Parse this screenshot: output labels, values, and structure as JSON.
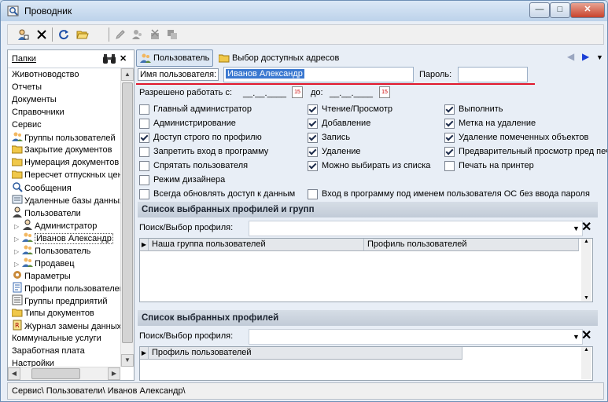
{
  "window": {
    "title": "Проводник",
    "minimize": "—",
    "maximize": "□",
    "close": "✕"
  },
  "left_panel": {
    "header": "Папки",
    "tree": [
      {
        "label": "Животноводство",
        "indent": 0,
        "icon": ""
      },
      {
        "label": "Отчеты",
        "indent": 0,
        "icon": ""
      },
      {
        "label": "Документы",
        "indent": 0,
        "icon": ""
      },
      {
        "label": "Справочники",
        "indent": 0,
        "icon": ""
      },
      {
        "label": "Сервис",
        "indent": 0,
        "icon": ""
      },
      {
        "label": "Группы пользователей",
        "indent": 1,
        "icon": "users-icon"
      },
      {
        "label": "Закрытие документов",
        "indent": 1,
        "icon": "folder-icon"
      },
      {
        "label": "Нумерация документов",
        "indent": 1,
        "icon": "folder-icon"
      },
      {
        "label": "Пересчет отпускных цен",
        "indent": 1,
        "icon": "folder-icon"
      },
      {
        "label": "Сообщения",
        "indent": 1,
        "icon": "message-icon"
      },
      {
        "label": "Удаленные базы данных",
        "indent": 1,
        "icon": "database-icon"
      },
      {
        "label": "Пользователи",
        "indent": 1,
        "icon": "user-icon"
      },
      {
        "label": "Администратор",
        "indent": 2,
        "icon": "user-icon"
      },
      {
        "label": "Иванов Александр",
        "indent": 2,
        "icon": "users-icon",
        "selected": true
      },
      {
        "label": "Пользователь",
        "indent": 2,
        "icon": "users-icon"
      },
      {
        "label": "Продавец",
        "indent": 2,
        "icon": "users-icon"
      },
      {
        "label": "Параметры",
        "indent": 1,
        "icon": "gear-icon"
      },
      {
        "label": "Профили пользователей",
        "indent": 1,
        "icon": "profile-icon"
      },
      {
        "label": "Группы предприятий",
        "indent": 1,
        "icon": "list-icon"
      },
      {
        "label": "Типы документов",
        "indent": 1,
        "icon": "folder-icon"
      },
      {
        "label": "Журнал замены данных",
        "indent": 1,
        "icon": "journal-icon"
      },
      {
        "label": "Коммунальные услуги",
        "indent": 0,
        "icon": ""
      },
      {
        "label": "Заработная плата",
        "indent": 0,
        "icon": ""
      },
      {
        "label": "Настройки",
        "indent": 0,
        "icon": ""
      }
    ]
  },
  "tabs": {
    "user": "Пользователь",
    "addresses": "Выбор доступных адресов"
  },
  "form": {
    "username_label": "Имя пользователя:",
    "username_value": "Иванов Александр",
    "password_label": "Пароль:",
    "password_value": "",
    "allowed_from_label": "Разрешено работать с:",
    "date_placeholder": "__.__.____",
    "to_label": "до:",
    "calendar_day": "15"
  },
  "checkboxes": {
    "col1": [
      {
        "label": "Главный администратор",
        "checked": false
      },
      {
        "label": "Администрирование",
        "checked": false
      },
      {
        "label": "Доступ строго по профилю",
        "checked": true
      },
      {
        "label": "Запретить вход в программу",
        "checked": false
      },
      {
        "label": "Спрятать пользователя",
        "checked": false
      },
      {
        "label": "Режим дизайнера",
        "checked": false
      },
      {
        "label": "Всегда обновлять доступ к данным",
        "checked": false
      }
    ],
    "col2": [
      {
        "label": "Чтение/Просмотр",
        "checked": true
      },
      {
        "label": "Добавление",
        "checked": true
      },
      {
        "label": "Запись",
        "checked": true
      },
      {
        "label": "Удаление",
        "checked": true
      },
      {
        "label": "Можно выбирать из списка",
        "checked": true
      }
    ],
    "col3": [
      {
        "label": "Выполнить",
        "checked": true
      },
      {
        "label": "Метка на удаление",
        "checked": true
      },
      {
        "label": "Удаление помеченных объектов",
        "checked": true
      },
      {
        "label": "Предварительный просмотр пред печ",
        "checked": true
      },
      {
        "label": "Печать на принтер",
        "checked": false
      }
    ],
    "os_login": {
      "label": "Вход в программу под именем пользователя ОС без ввода пароля",
      "checked": false
    }
  },
  "section1": {
    "title": "Список выбранных профилей и групп",
    "search_label": "Поиск/Выбор профиля:",
    "columns": [
      "Наша группа пользователей",
      "Профиль пользователей"
    ]
  },
  "section2": {
    "title": "Список выбранных профилей",
    "search_label": "Поиск/Выбор профиля:",
    "columns": [
      "Профиль пользователей"
    ]
  },
  "status": {
    "path": "Сервис\\ Пользователи\\ Иванов Александр\\"
  },
  "colors": {
    "accent_red": "#e0182c",
    "selection_blue": "#3a78d0",
    "title_bg": "#bcd2ea"
  }
}
